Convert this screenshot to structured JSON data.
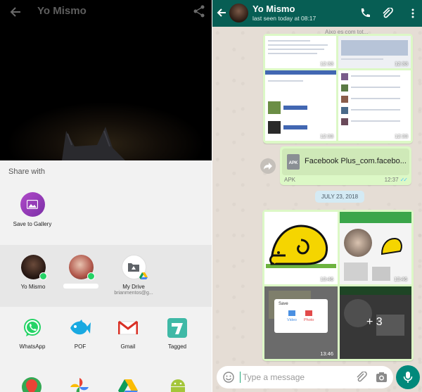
{
  "share_sheet": {
    "preview_title": "Yo Mismo",
    "share_with_label": "Share with",
    "gallery_label": "Save to Gallery",
    "contacts": [
      {
        "label": "Yo Mismo"
      },
      {
        "label": ""
      },
      {
        "label": "My Drive",
        "sub": "brianmentos@g..."
      }
    ],
    "apps": [
      {
        "label": "WhatsApp"
      },
      {
        "label": "POF"
      },
      {
        "label": "Gmail"
      },
      {
        "label": "Tagged"
      }
    ]
  },
  "chat": {
    "contact_name": "Yo Mismo",
    "last_seen": "last seen today at 08:17",
    "partial_preview_text": "Aixo es com tot...",
    "msg1_times": [
      "12:33",
      "12:33",
      "12:33",
      "12:33"
    ],
    "file_name": "Facebook Plus_com.facebo...",
    "file_type": "APK",
    "file_time": "12:37",
    "date_chip": "JULY 23, 2018",
    "image_times": [
      "13:46",
      "13:46",
      "13:46"
    ],
    "more_count": "+ 3",
    "save_dialog": {
      "title": "Save",
      "option1": "Video",
      "option2": "Photo"
    },
    "input_placeholder": "Type a message"
  },
  "colors": {
    "whatsapp_header": "#075e54",
    "bubble": "#dcf8c6",
    "chat_bg": "#e5ddd5",
    "mic_button": "#00897b"
  }
}
